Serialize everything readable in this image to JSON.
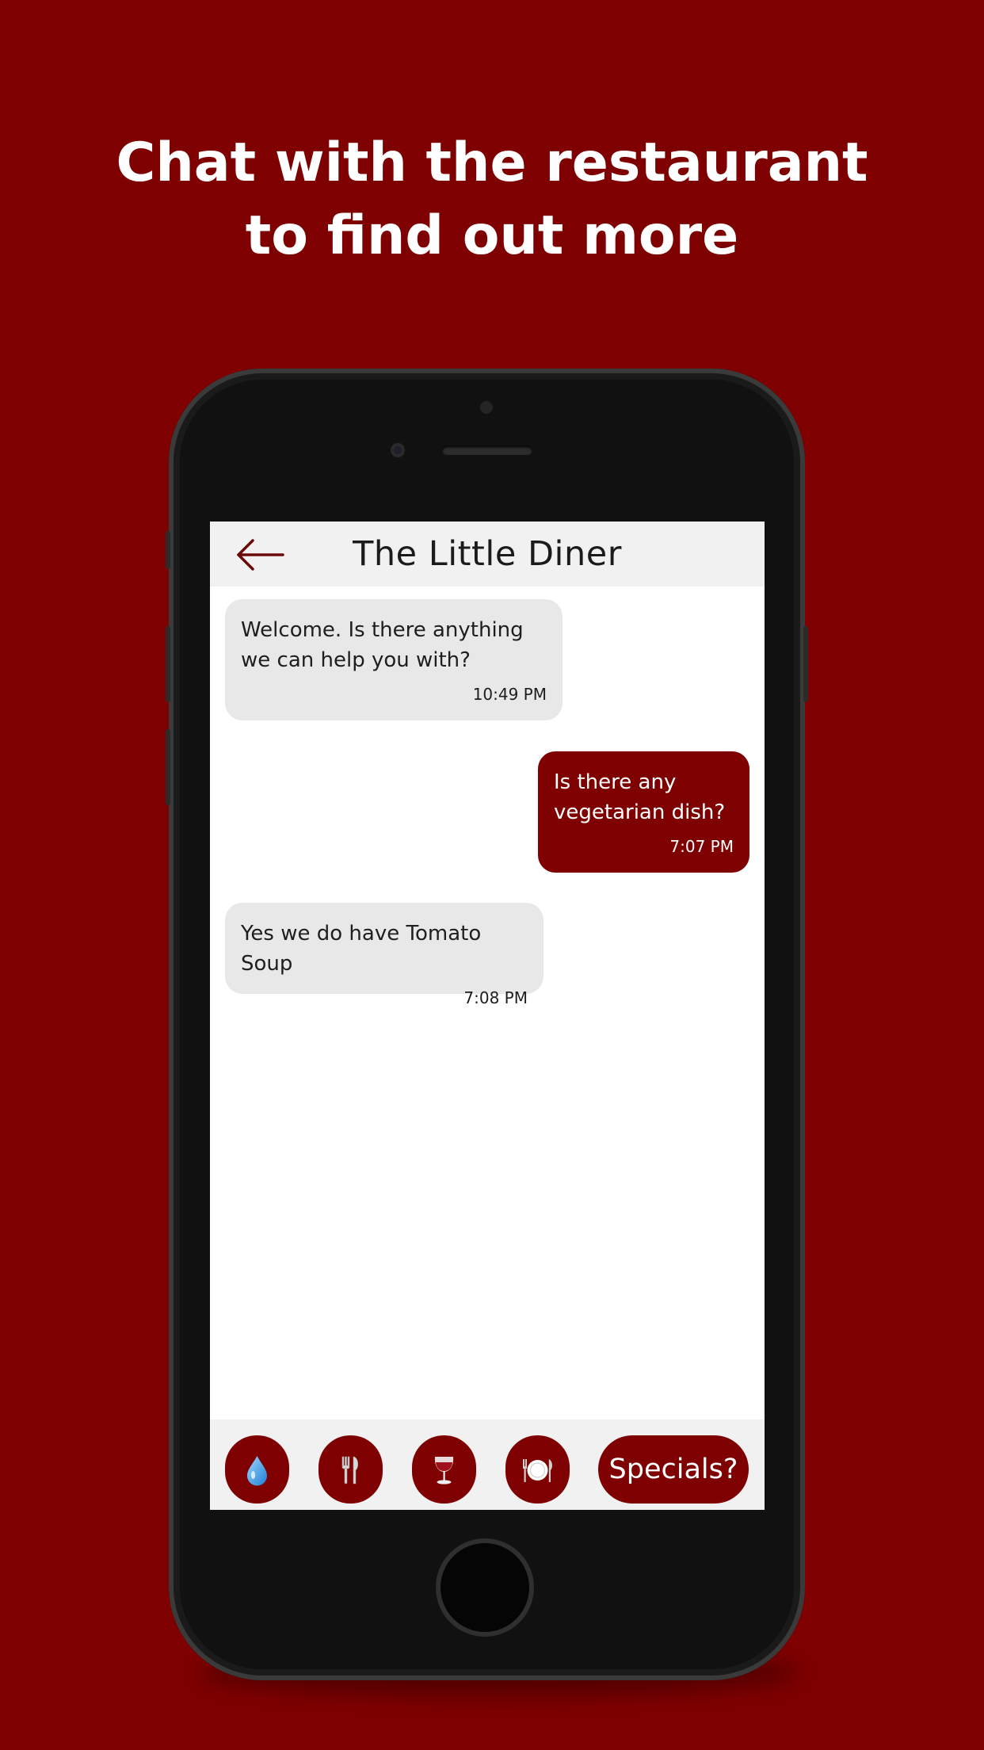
{
  "promo": {
    "line1": "Chat with the restaurant",
    "line2": "to find out more"
  },
  "chat": {
    "title": "The Little Diner",
    "messages": [
      {
        "direction": "incoming",
        "text": "Welcome. Is there anything we can help you with?",
        "time": "10:49 PM"
      },
      {
        "direction": "outgoing",
        "text": "Is there any vegetarian dish?",
        "time": "7:07 PM"
      },
      {
        "direction": "incoming",
        "text": "Yes we do have Tomato Soup",
        "time": "7:08 PM"
      }
    ]
  },
  "quick_replies": {
    "buttons": [
      {
        "icon": "water-drop-icon"
      },
      {
        "icon": "fork-and-knife-icon"
      },
      {
        "icon": "wine-glass-icon"
      },
      {
        "icon": "plate-icon"
      }
    ],
    "specials_label": "Specials?"
  },
  "colors": {
    "brand": "#7f0000",
    "bubble_incoming": "#e8e8e8",
    "nav_background": "#f1f1f1"
  }
}
